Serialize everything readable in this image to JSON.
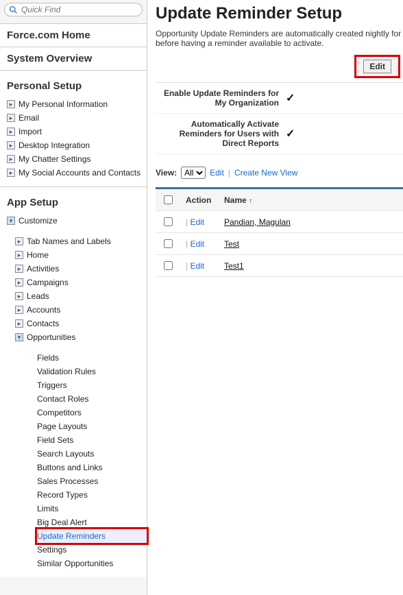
{
  "sidebar": {
    "search_placeholder": "Quick Find",
    "forceHome": "Force.com Home",
    "systemOverview": "System Overview",
    "personalSetup": {
      "title": "Personal Setup",
      "items": [
        "My Personal Information",
        "Email",
        "Import",
        "Desktop Integration",
        "My Chatter Settings",
        "My Social Accounts and Contacts"
      ]
    },
    "appSetup": {
      "title": "App Setup",
      "customize": "Customize",
      "customizeItems": [
        "Tab Names and Labels",
        "Home",
        "Activities",
        "Campaigns",
        "Leads",
        "Accounts",
        "Contacts"
      ],
      "opportunities": "Opportunities",
      "oppItems": [
        "Fields",
        "Validation Rules",
        "Triggers",
        "Contact Roles",
        "Competitors",
        "Page Layouts",
        "Field Sets",
        "Search Layouts",
        "Buttons and Links",
        "Sales Processes",
        "Record Types",
        "Limits",
        "Big Deal Alert",
        "Update Reminders",
        "Settings",
        "Similar Opportunities"
      ]
    }
  },
  "main": {
    "title": "Update Reminder Setup",
    "description": "Opportunity Update Reminders are automatically created nightly for before having a reminder available to activate.",
    "editButton": "Edit",
    "settings": [
      {
        "label": "Enable Update Reminders for My Organization",
        "value": "✓"
      },
      {
        "label": "Automatically Activate Reminders for Users with Direct Reports",
        "value": "✓"
      }
    ],
    "view": {
      "label": "View:",
      "options": [
        "All"
      ],
      "selected": "All",
      "editLink": "Edit",
      "createLink": "Create New View"
    },
    "table": {
      "cols": {
        "action": "Action",
        "name": "Name"
      },
      "rowEdit": "Edit",
      "rows": [
        {
          "name": "Pandian, Magulan"
        },
        {
          "name": "Test"
        },
        {
          "name": "Test1"
        }
      ]
    }
  }
}
